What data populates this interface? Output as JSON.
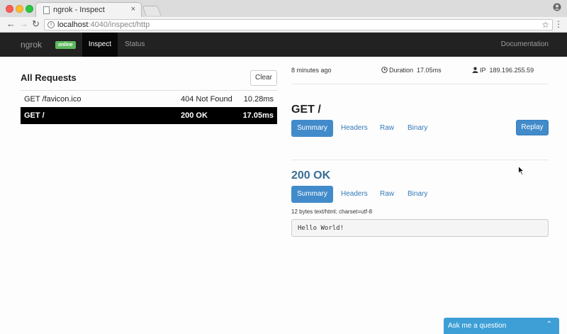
{
  "browser": {
    "tab_title": "ngrok - Inspect",
    "tab_close": "×",
    "url_host": "localhost",
    "url_rest": ":4040/inspect/http",
    "back": "←",
    "forward": "→",
    "reload": "↻",
    "info": "i",
    "star": "☆",
    "menu": "⋮"
  },
  "navbar": {
    "brand": "ngrok",
    "badge": "online",
    "tabs": [
      {
        "label": "Inspect",
        "active": true
      },
      {
        "label": "Status",
        "active": false
      }
    ],
    "docs": "Documentation"
  },
  "requests": {
    "title": "All Requests",
    "clear_label": "Clear",
    "rows": [
      {
        "path": "GET /favicon.ico",
        "status": "404 Not Found",
        "duration": "10.28ms",
        "selected": false
      },
      {
        "path": "GET /",
        "status": "200 OK",
        "duration": "17.05ms",
        "selected": true
      }
    ]
  },
  "detail": {
    "time_ago": "8 minutes ago",
    "duration_label": "Duration",
    "duration_value": "17.05ms",
    "ip_label": "IP",
    "ip_value": "189.196.255.59",
    "request_title": "GET /",
    "request_tabs": [
      "Summary",
      "Headers",
      "Raw",
      "Binary"
    ],
    "replay_label": "Replay",
    "response_title": "200 OK",
    "response_tabs": [
      "Summary",
      "Headers",
      "Raw",
      "Binary"
    ],
    "content_type": "12 bytes text/html; charset=utf-8",
    "body": "Hello World!"
  },
  "widget": {
    "label": "Ask me a question",
    "chevron": "⌃"
  },
  "colors": {
    "navbar_bg": "#222222",
    "accent": "#428bca",
    "badge": "#5cb85c",
    "response_title": "#3a6d93",
    "widget": "#3d9fd6"
  }
}
